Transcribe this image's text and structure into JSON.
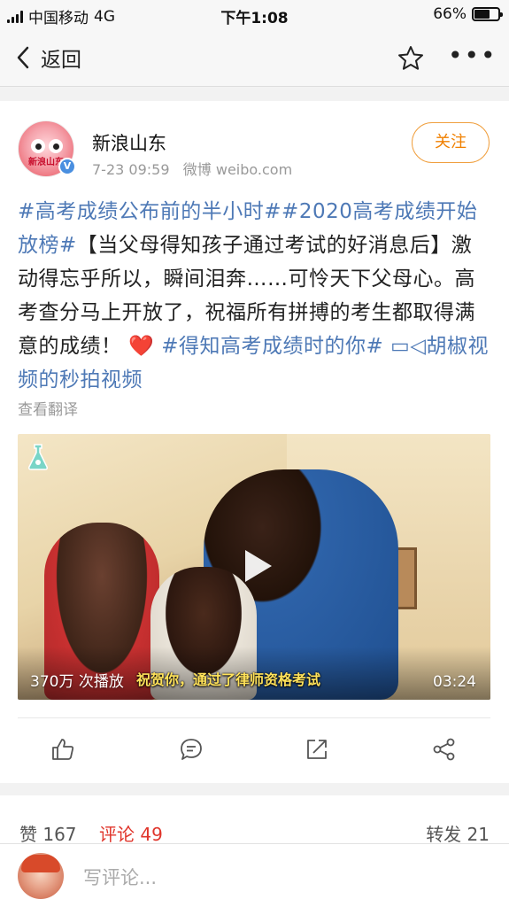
{
  "status_bar": {
    "carrier": "中国移动",
    "network": "4G",
    "time": "下午1:08",
    "battery": "66%",
    "battery_level": 0.66
  },
  "nav": {
    "back_label": "返回",
    "star_icon": "star-outline-icon",
    "more_icon": "more-dots-icon"
  },
  "post": {
    "author": "新浪山东",
    "avatar_text": "新浪山东",
    "time": "7-23 09:59",
    "source": "微博 weibo.com",
    "follow_label": "关注",
    "segments": [
      {
        "text": "#高考成绩公布前的半小时##2020高考成绩开始放榜#",
        "kind": "tag"
      },
      {
        "text": "【当父母得知孩子通过考试的好消息后】激动得忘乎所以，瞬间泪奔……可怜天下父母心。高考查分马上开放了，祝福所有拼搏的考生都取得满意的成绩！",
        "kind": "plain"
      },
      {
        "text": "❤️",
        "kind": "heart"
      },
      {
        "text": " #得知高考成绩时的你#",
        "kind": "tag"
      },
      {
        "text": " ▭◁胡椒视频的秒拍视频",
        "kind": "tag"
      }
    ],
    "translate_label": "查看翻译"
  },
  "video": {
    "views": "370万 次播放",
    "subtitle": "祝贺你，通过了律师资格考试",
    "duration": "03:24"
  },
  "actions": [
    {
      "name": "like-icon"
    },
    {
      "name": "comment-icon"
    },
    {
      "name": "repost-icon"
    },
    {
      "name": "share-icon"
    }
  ],
  "stats": {
    "likes_label": "赞 167",
    "comments_label": "评论 49",
    "reposts_label": "转发 21"
  },
  "composer": {
    "placeholder": "写评论..."
  },
  "colors": {
    "tag": "#4e79b6",
    "follow": "#f08000",
    "comment_active": "#e0352b",
    "divider": "#e8e8e8"
  }
}
